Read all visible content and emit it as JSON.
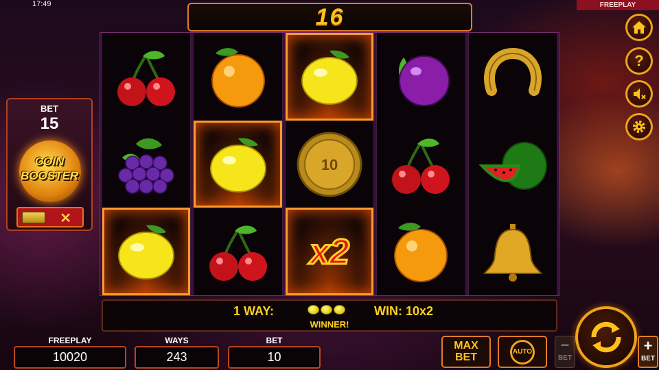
{
  "status_bar": {
    "time": "17:49",
    "mode": "FREEPLAY"
  },
  "win_counter": "16",
  "coin_booster": {
    "bet_label": "BET",
    "bet_value": "15",
    "title_line1": "COIN",
    "title_line2": "BOOSTER",
    "toggle_off_symbol": "✕"
  },
  "reels": [
    [
      "cherries",
      "grapes",
      "lemon"
    ],
    [
      "orange",
      "lemon",
      "cherries"
    ],
    [
      "lemon",
      "coin-10",
      "x2-multiplier"
    ],
    [
      "plum",
      "cherries",
      "orange"
    ],
    [
      "horseshoe",
      "watermelon",
      "bell"
    ]
  ],
  "highlighted_cells": [
    [
      0,
      2
    ],
    [
      1,
      1
    ],
    [
      2,
      0
    ],
    [
      2,
      2
    ]
  ],
  "coin_symbol_value": "10",
  "multiplier_text": "x2",
  "win_line": {
    "ways": "1 WAY:",
    "win": "WIN: 10x2",
    "status": "WINNER!"
  },
  "stats": {
    "freeplay_label": "FREEPLAY",
    "freeplay_value": "10020",
    "ways_label": "WAYS",
    "ways_value": "243",
    "bet_label": "BET",
    "bet_value": "10"
  },
  "buttons": {
    "max_bet_line1": "MAX",
    "max_bet_line2": "BET",
    "auto_label": "AUTO",
    "bet_minus_symbol": "−",
    "bet_minus_label": "BET",
    "bet_plus_symbol": "+",
    "bet_plus_label": "BET"
  },
  "side_menu": [
    {
      "name": "home-icon"
    },
    {
      "name": "help-icon",
      "glyph": "?"
    },
    {
      "name": "sound-muted-icon"
    },
    {
      "name": "settings-icon"
    }
  ],
  "colors": {
    "gold": "#ffc21a",
    "panel_border": "#b8451f",
    "fire": "#ff9b2a"
  }
}
